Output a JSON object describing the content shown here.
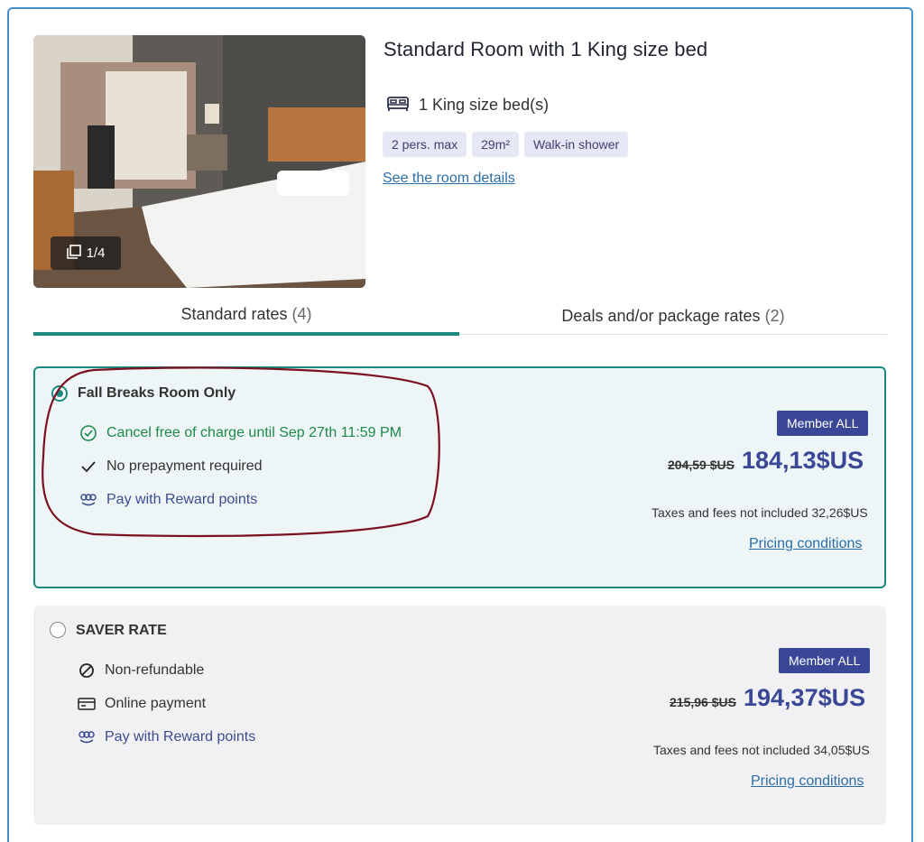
{
  "room": {
    "title": "Standard Room with 1 King size bed",
    "bed": "1 King size bed(s)",
    "tags": [
      "2 pers. max",
      "29m²",
      "Walk-in shower"
    ],
    "details_link": "See the room details",
    "photo_counter": "1/4"
  },
  "tabs": [
    {
      "label": "Standard rates",
      "count": "(4)",
      "active": true
    },
    {
      "label": "Deals and/or package rates",
      "count": "(2)",
      "active": false
    }
  ],
  "rates": [
    {
      "name": "Fall Breaks Room Only",
      "selected": true,
      "perks": [
        {
          "icon": "check-circle-icon",
          "text": "Cancel free of charge until Sep 27th 11:59 PM"
        },
        {
          "icon": "check-icon",
          "text": "No prepayment required"
        },
        {
          "icon": "reward-points-icon",
          "text": "Pay with Reward points"
        }
      ],
      "badge": "Member ALL",
      "old_price": "204,59 $US",
      "price": "184,13$US",
      "taxes": "Taxes and fees not included 32,26$US",
      "pricing_link": "Pricing conditions"
    },
    {
      "name": "SAVER RATE",
      "selected": false,
      "perks": [
        {
          "icon": "non-refundable-icon",
          "text": "Non-refundable"
        },
        {
          "icon": "credit-card-icon",
          "text": "Online payment"
        },
        {
          "icon": "reward-points-icon",
          "text": "Pay with Reward points"
        }
      ],
      "badge": "Member ALL",
      "old_price": "215,96 $US",
      "price": "194,37$US",
      "taxes": "Taxes and fees not included 34,05$US",
      "pricing_link": "Pricing conditions"
    }
  ],
  "colors": {
    "accent_teal": "#1a8a7e",
    "brand_navy": "#3a4796",
    "link_blue": "#2b6ea8",
    "success_green": "#1d8a4a",
    "highlight_ellipse": "#7a1020",
    "frame_border": "#4a90c8"
  }
}
